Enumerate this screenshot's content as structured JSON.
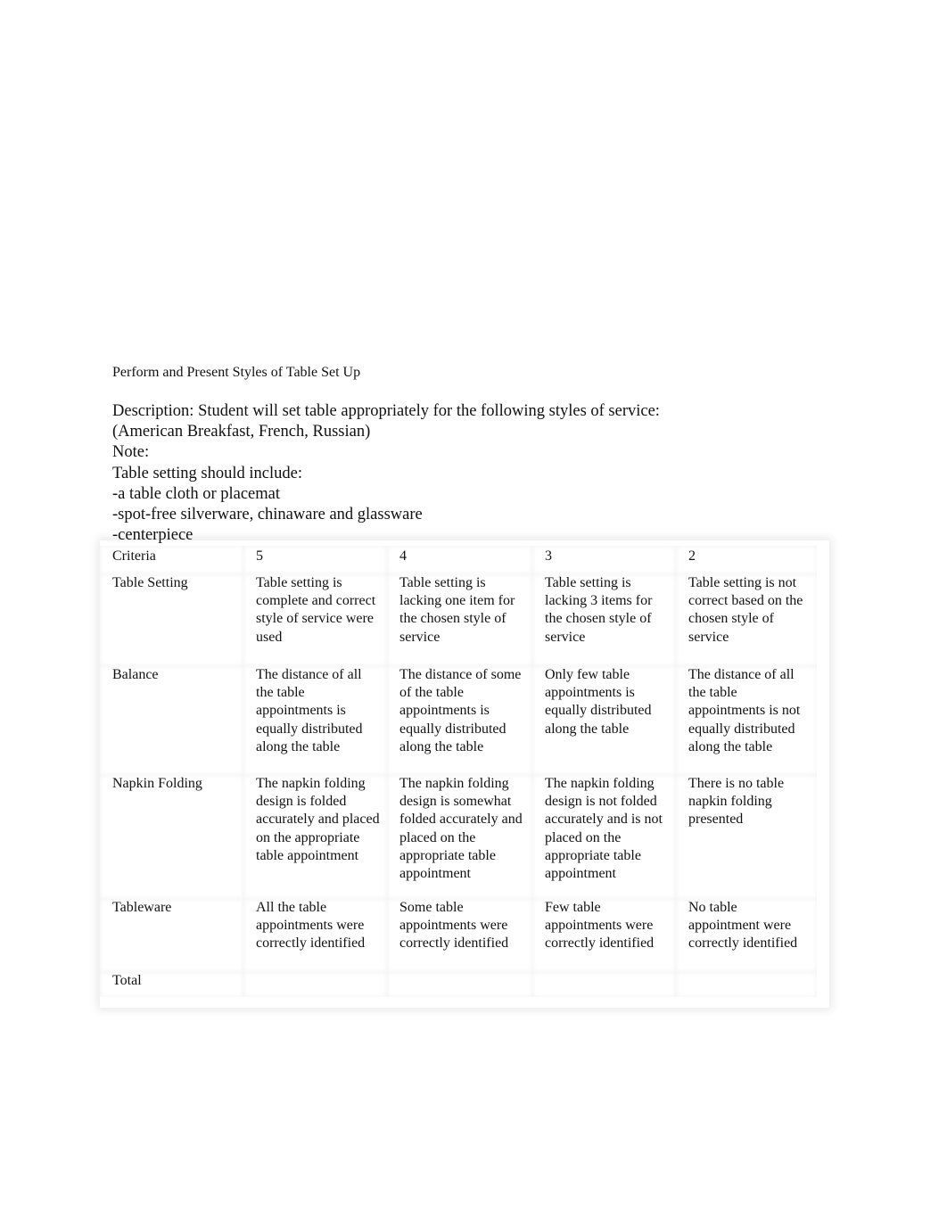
{
  "document": {
    "title": "Perform and Present Styles of Table Set Up",
    "description_lines": [
      "Description: Student will set table appropriately for the following styles of service:",
      "(American Breakfast, French, Russian)",
      "Note:",
      "Table setting should include:",
      "-a table cloth or placemat",
      "-spot-free silverware, chinaware and glassware",
      "-centerpiece"
    ]
  },
  "rubric": {
    "headers": [
      "Criteria",
      "5",
      "4",
      "3",
      "2"
    ],
    "rows": [
      {
        "criteria": "Table Setting",
        "cells": [
          "Table setting is complete and correct style of service were used",
          "Table setting is lacking one item for the chosen style of service",
          "Table setting is lacking 3 items for the chosen style of service",
          "Table setting is not correct based on the chosen style of service"
        ]
      },
      {
        "criteria": "Balance",
        "cells": [
          "The distance of all the table appointments is equally distributed along the table",
          "The distance of some of the table appointments is equally distributed along the table",
          "Only few table appointments is equally distributed along the table",
          "The distance of all the table appointments is not equally distributed along the table"
        ]
      },
      {
        "criteria": "Napkin Folding",
        "cells": [
          "The napkin folding design is folded accurately and placed on the appropriate table appointment",
          "The napkin folding design is somewhat folded accurately and placed on the appropriate table appointment",
          "The napkin folding design is not folded accurately and is not placed on the appropriate table appointment",
          "There is no table napkin folding presented"
        ]
      },
      {
        "criteria": "Tableware",
        "cells": [
          "All the table appointments were correctly identified",
          "Some table appointments were correctly identified",
          "Few table appointments were correctly identified",
          "No table appointment were correctly identified"
        ]
      },
      {
        "criteria": "Total",
        "cells": [
          "",
          "",
          "",
          ""
        ]
      }
    ]
  }
}
